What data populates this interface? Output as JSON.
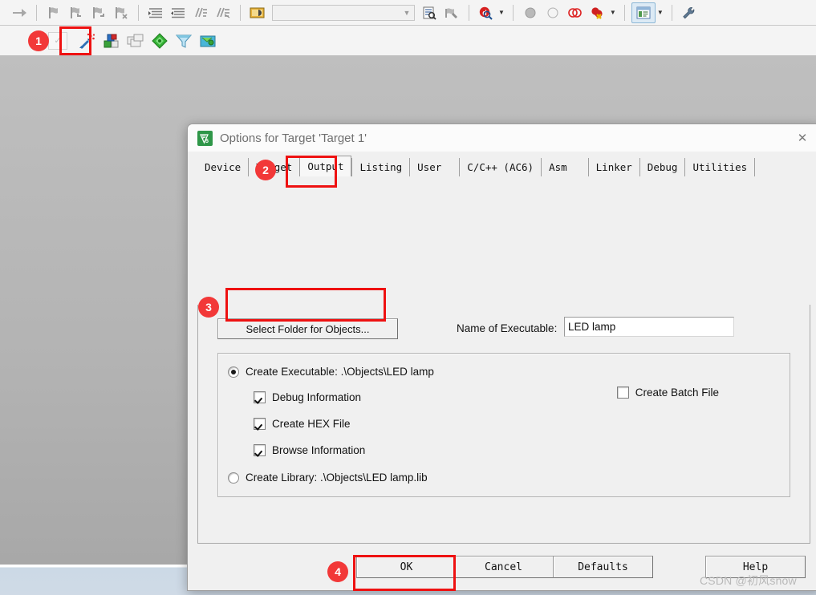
{
  "toolbar_row1": {
    "items": [
      {
        "name": "step-out-arrow-icon",
        "glyph": "arrow-right"
      },
      {
        "name": "separator",
        "glyph": "sep"
      },
      {
        "name": "bookmark-toggle-icon",
        "glyph": "flag"
      },
      {
        "name": "bookmark-prev-icon",
        "glyph": "flag-left"
      },
      {
        "name": "bookmark-next-icon",
        "glyph": "flag-right"
      },
      {
        "name": "bookmark-clear-icon",
        "glyph": "flag-x"
      },
      {
        "name": "separator",
        "glyph": "sep"
      },
      {
        "name": "indent-icon",
        "glyph": "indent"
      },
      {
        "name": "outdent-icon",
        "glyph": "outdent"
      },
      {
        "name": "comment-icon",
        "glyph": "comment"
      },
      {
        "name": "uncomment-icon",
        "glyph": "uncomment"
      },
      {
        "name": "separator",
        "glyph": "sep"
      },
      {
        "name": "open-file-icon",
        "glyph": "openfile"
      }
    ],
    "search_combo": {
      "value": "",
      "placeholder": ""
    },
    "items_after": [
      {
        "name": "find-in-files-icon",
        "glyph": "findfiles"
      },
      {
        "name": "bookmark-tool-icon",
        "glyph": "wrench2"
      },
      {
        "name": "separator",
        "glyph": "sep"
      },
      {
        "name": "quick-find-icon",
        "glyph": "qfind"
      },
      {
        "name": "separator",
        "glyph": "sep"
      },
      {
        "name": "breakpoint-icon",
        "glyph": "dot-gray"
      },
      {
        "name": "breakpoint-disable-icon",
        "glyph": "dot-hollow"
      },
      {
        "name": "breakpoint-disable-all-icon",
        "glyph": "dots-red-outline"
      },
      {
        "name": "breakpoint-kill-all-icon",
        "glyph": "dot-red-x"
      },
      {
        "name": "separator",
        "glyph": "sep"
      },
      {
        "name": "window-manager-icon",
        "glyph": "winmgr"
      },
      {
        "name": "separator",
        "glyph": "sep"
      },
      {
        "name": "configure-tools-icon",
        "glyph": "wrench"
      }
    ]
  },
  "toolbar_row2": {
    "items": [
      {
        "name": "target-options-icon",
        "glyph": "magicwand",
        "highlighted": true
      },
      {
        "name": "manage-project-items-icon",
        "glyph": "cubes"
      },
      {
        "name": "manage-multi-project-icon",
        "glyph": "windows-stack"
      },
      {
        "name": "green-diamond-icon",
        "glyph": "diamond-green"
      },
      {
        "name": "pack-installer-icon",
        "glyph": "funnel"
      },
      {
        "name": "manage-run-env-icon",
        "glyph": "green-box"
      }
    ]
  },
  "dialog": {
    "title": "Options for Target 'Target 1'",
    "app_icon": "keil-uvision-icon",
    "close_label": "✕",
    "tabs": [
      {
        "label": "Device",
        "active": false
      },
      {
        "label": "Target",
        "active": false
      },
      {
        "label": "Output",
        "active": true
      },
      {
        "label": "Listing",
        "active": false
      },
      {
        "label": "User",
        "active": false
      },
      {
        "label": "C/C++ (AC6)",
        "active": false
      },
      {
        "label": "Asm",
        "active": false
      },
      {
        "label": "Linker",
        "active": false
      },
      {
        "label": "Debug",
        "active": false
      },
      {
        "label": "Utilities",
        "active": false
      }
    ],
    "output": {
      "select_folder_button": "Select Folder for Objects...",
      "name_of_executable_label": "Name of Executable:",
      "name_of_executable_value": "LED lamp",
      "create_executable_label": "Create Executable:  .\\Objects\\LED lamp",
      "create_executable_checked": true,
      "debug_information_label": "Debug Information",
      "debug_information_checked": true,
      "create_hex_file_label": "Create HEX File",
      "create_hex_file_checked": true,
      "browse_information_label": "Browse Information",
      "browse_information_checked": true,
      "create_batch_file_label": "Create Batch File",
      "create_batch_file_checked": false,
      "create_library_label": "Create Library:  .\\Objects\\LED lamp.lib",
      "create_library_checked": false
    },
    "footer": {
      "ok": "OK",
      "cancel": "Cancel",
      "defaults": "Defaults",
      "help": "Help"
    }
  },
  "annotations": {
    "badge1": "1",
    "badge2": "2",
    "badge3": "3",
    "badge4": "4",
    "accent_color": "#f23838",
    "box_color": "#ee1111"
  },
  "watermark": "CSDN @初风snow"
}
